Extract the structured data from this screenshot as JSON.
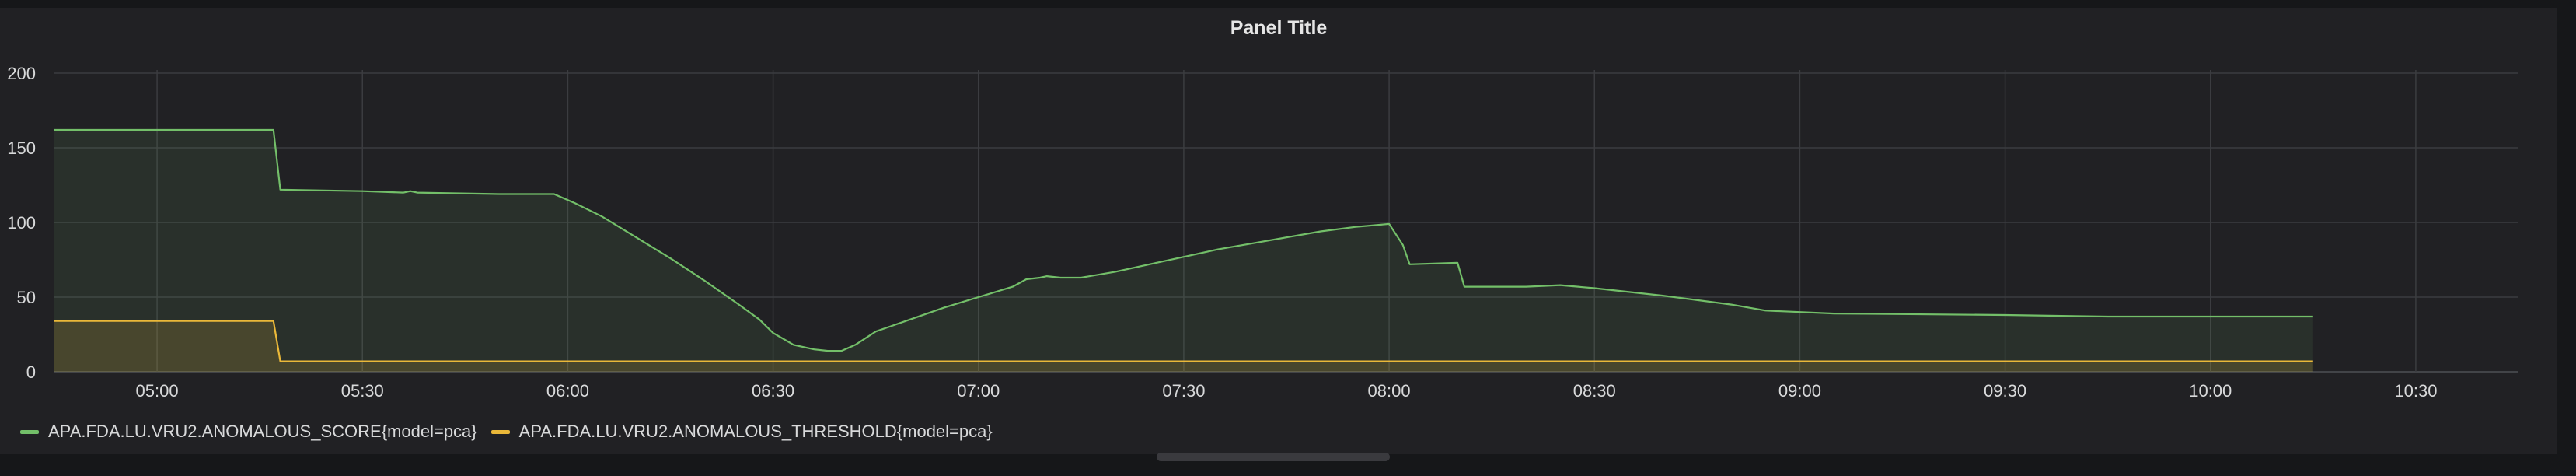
{
  "panel": {
    "title": "Panel Title"
  },
  "chart_data": {
    "type": "area",
    "title": "Panel Title",
    "x_unit": "time (HH:MM)",
    "xlim": [
      "04:45",
      "10:45"
    ],
    "ylim": [
      0,
      200
    ],
    "y_ticks": [
      0,
      50,
      100,
      150,
      200
    ],
    "x_ticks": [
      "05:00",
      "05:30",
      "06:00",
      "06:30",
      "07:00",
      "07:30",
      "08:00",
      "08:30",
      "09:00",
      "09:30",
      "10:00",
      "10:30"
    ],
    "grid": true,
    "legend_position": "bottom-left",
    "series": [
      {
        "name": "APA.FDA.LU.VRU2.ANOMALOUS_SCORE{model=pca}",
        "color": "#73bf69",
        "points": [
          [
            "04:45",
            162
          ],
          [
            "05:03",
            162
          ],
          [
            "05:17",
            162
          ],
          [
            "05:18",
            122
          ],
          [
            "05:30",
            121
          ],
          [
            "05:36",
            120
          ],
          [
            "05:37",
            121
          ],
          [
            "05:38",
            120
          ],
          [
            "05:50",
            119
          ],
          [
            "05:58",
            119
          ],
          [
            "06:01",
            113
          ],
          [
            "06:05",
            104
          ],
          [
            "06:10",
            90
          ],
          [
            "06:15",
            76
          ],
          [
            "06:20",
            61
          ],
          [
            "06:25",
            45
          ],
          [
            "06:28",
            35
          ],
          [
            "06:30",
            26
          ],
          [
            "06:33",
            18
          ],
          [
            "06:36",
            15
          ],
          [
            "06:38",
            14
          ],
          [
            "06:40",
            14
          ],
          [
            "06:42",
            18
          ],
          [
            "06:45",
            27
          ],
          [
            "06:50",
            35
          ],
          [
            "06:55",
            43
          ],
          [
            "07:00",
            50
          ],
          [
            "07:05",
            57
          ],
          [
            "07:07",
            62
          ],
          [
            "07:09",
            63
          ],
          [
            "07:10",
            64
          ],
          [
            "07:12",
            63
          ],
          [
            "07:15",
            63
          ],
          [
            "07:20",
            67
          ],
          [
            "07:25",
            72
          ],
          [
            "07:30",
            77
          ],
          [
            "07:35",
            82
          ],
          [
            "07:40",
            86
          ],
          [
            "07:45",
            90
          ],
          [
            "07:50",
            94
          ],
          [
            "07:55",
            97
          ],
          [
            "08:00",
            99
          ],
          [
            "08:02",
            85
          ],
          [
            "08:03",
            72
          ],
          [
            "08:10",
            73
          ],
          [
            "08:11",
            57
          ],
          [
            "08:20",
            57
          ],
          [
            "08:25",
            58
          ],
          [
            "08:30",
            56
          ],
          [
            "08:40",
            51
          ],
          [
            "08:50",
            45
          ],
          [
            "08:55",
            41
          ],
          [
            "09:00",
            40
          ],
          [
            "09:05",
            39
          ],
          [
            "09:30",
            38
          ],
          [
            "09:45",
            37
          ],
          [
            "10:00",
            37
          ],
          [
            "10:15",
            37
          ]
        ]
      },
      {
        "name": "APA.FDA.LU.VRU2.ANOMALOUS_THRESHOLD{model=pca}",
        "color": "#eab839",
        "points": [
          [
            "04:45",
            34
          ],
          [
            "05:17",
            34
          ],
          [
            "05:18",
            7
          ],
          [
            "06:00",
            7
          ],
          [
            "07:00",
            7
          ],
          [
            "08:00",
            7
          ],
          [
            "09:00",
            7
          ],
          [
            "10:00",
            7
          ],
          [
            "10:15",
            7
          ]
        ]
      }
    ]
  }
}
